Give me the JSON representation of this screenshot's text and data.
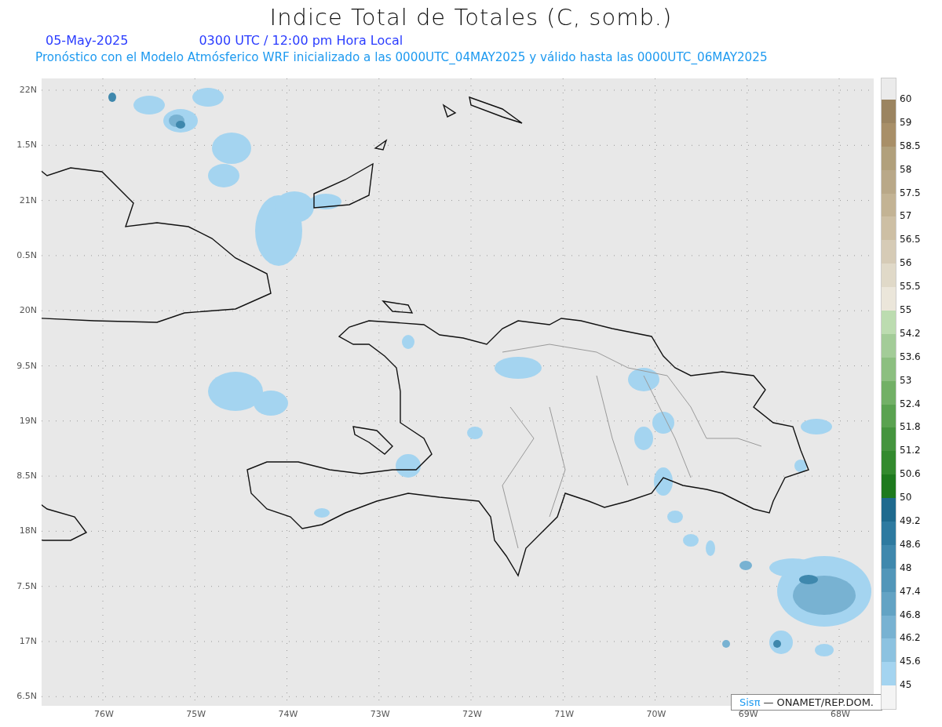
{
  "title": "Indice Total de Totales (C, somb.)",
  "date": "05-May-2025",
  "time": "0300 UTC / 12:00 pm Hora Local",
  "subtitle": "Pronóstico con el Modelo Atmósferico WRF inicializado a las 0000UTC_04MAY2025 y válido hasta las  0000UTC_06MAY2025",
  "y_ticks": [
    "22N",
    "1.5N",
    "21N",
    "0.5N",
    "20N",
    "9.5N",
    "19N",
    "8.5N",
    "18N",
    "7.5N",
    "17N",
    "6.5N"
  ],
  "x_ticks": [
    "76W",
    "75W",
    "74W",
    "73W",
    "72W",
    "71W",
    "70W",
    "69W",
    "68W"
  ],
  "credit": {
    "brand": "Sisπ",
    "text": "— ONAMET/REP.DOM."
  },
  "colorbar": {
    "levels": [
      {
        "label": "60",
        "color": "#9b8460"
      },
      {
        "label": "59",
        "color": "#a88f68"
      },
      {
        "label": "58.5",
        "color": "#b1a07c"
      },
      {
        "label": "58",
        "color": "#b9a888"
      },
      {
        "label": "57.5",
        "color": "#c3b394"
      },
      {
        "label": "57",
        "color": "#cdbfa4"
      },
      {
        "label": "56.5",
        "color": "#d6cbb6"
      },
      {
        "label": "56",
        "color": "#e0d9c8"
      },
      {
        "label": "55.5",
        "color": "#ebe6da"
      },
      {
        "label": "55",
        "color": "#bcdcb0"
      },
      {
        "label": "54.2",
        "color": "#a3cc98"
      },
      {
        "label": "53.6",
        "color": "#8cbf80"
      },
      {
        "label": "53",
        "color": "#72b066"
      },
      {
        "label": "52.4",
        "color": "#5aa250"
      },
      {
        "label": "51.8",
        "color": "#45943e"
      },
      {
        "label": "51.2",
        "color": "#338a2e"
      },
      {
        "label": "50.6",
        "color": "#1e7a1e"
      },
      {
        "label": "50",
        "color": "#1f6a8e"
      },
      {
        "label": "49.2",
        "color": "#2e7aa0"
      },
      {
        "label": "48.6",
        "color": "#3f88ad"
      },
      {
        "label": "48",
        "color": "#5296b9"
      },
      {
        "label": "47.4",
        "color": "#63a3c4"
      },
      {
        "label": "46.8",
        "color": "#78b2d2"
      },
      {
        "label": "46.2",
        "color": "#8cc2e0"
      },
      {
        "label": "45.6",
        "color": "#a4d4f0"
      },
      {
        "label": "45",
        "color": "#f4f4f4"
      }
    ]
  }
}
